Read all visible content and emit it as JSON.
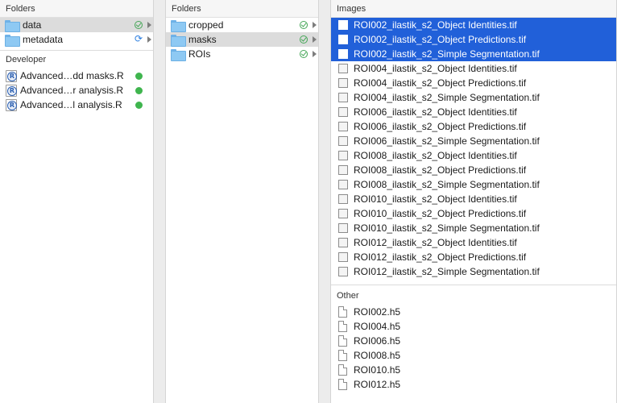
{
  "column1": {
    "folders_header": "Folders",
    "folders": [
      {
        "name": "data",
        "status": "synced",
        "selected": true
      },
      {
        "name": "metadata",
        "status": "syncing",
        "selected": false
      }
    ],
    "developer_header": "Developer",
    "developer_files": [
      {
        "name": "Advanced…dd masks.R",
        "status": "ok"
      },
      {
        "name": "Advanced…r analysis.R",
        "status": "ok"
      },
      {
        "name": "Advanced…l analysis.R",
        "status": "ok"
      }
    ]
  },
  "column2": {
    "folders_header": "Folders",
    "folders": [
      {
        "name": "cropped",
        "status": "synced",
        "selected": false
      },
      {
        "name": "masks",
        "status": "synced",
        "selected": true
      },
      {
        "name": "ROIs",
        "status": "synced",
        "selected": false
      }
    ]
  },
  "column3": {
    "images_header": "Images",
    "images": [
      {
        "name": "ROI002_ilastik_s2_Object Identities.tif",
        "selected": true
      },
      {
        "name": "ROI002_ilastik_s2_Object Predictions.tif",
        "selected": true
      },
      {
        "name": "ROI002_ilastik_s2_Simple Segmentation.tif",
        "selected": true
      },
      {
        "name": "ROI004_ilastik_s2_Object Identities.tif",
        "selected": false
      },
      {
        "name": "ROI004_ilastik_s2_Object Predictions.tif",
        "selected": false
      },
      {
        "name": "ROI004_ilastik_s2_Simple Segmentation.tif",
        "selected": false
      },
      {
        "name": "ROI006_ilastik_s2_Object Identities.tif",
        "selected": false
      },
      {
        "name": "ROI006_ilastik_s2_Object Predictions.tif",
        "selected": false
      },
      {
        "name": "ROI006_ilastik_s2_Simple Segmentation.tif",
        "selected": false
      },
      {
        "name": "ROI008_ilastik_s2_Object Identities.tif",
        "selected": false
      },
      {
        "name": "ROI008_ilastik_s2_Object Predictions.tif",
        "selected": false
      },
      {
        "name": "ROI008_ilastik_s2_Simple Segmentation.tif",
        "selected": false
      },
      {
        "name": "ROI010_ilastik_s2_Object Identities.tif",
        "selected": false
      },
      {
        "name": "ROI010_ilastik_s2_Object Predictions.tif",
        "selected": false
      },
      {
        "name": "ROI010_ilastik_s2_Simple Segmentation.tif",
        "selected": false
      },
      {
        "name": "ROI012_ilastik_s2_Object Identities.tif",
        "selected": false
      },
      {
        "name": "ROI012_ilastik_s2_Object Predictions.tif",
        "selected": false
      },
      {
        "name": "ROI012_ilastik_s2_Simple Segmentation.tif",
        "selected": false
      }
    ],
    "other_header": "Other",
    "other_files": [
      {
        "name": "ROI002.h5"
      },
      {
        "name": "ROI004.h5"
      },
      {
        "name": "ROI006.h5"
      },
      {
        "name": "ROI008.h5"
      },
      {
        "name": "ROI010.h5"
      },
      {
        "name": "ROI012.h5"
      }
    ]
  },
  "icons": {
    "folder": "folder-icon",
    "r_script": "r-file-icon",
    "image_file": "image-file-icon",
    "generic_file": "document-icon",
    "synced": "sync-check-icon",
    "syncing": "sync-arrows-icon",
    "ok_dot": "green-dot-icon",
    "expand": "chevron-right-icon"
  },
  "colors": {
    "selection_blue": "#2160d9",
    "selection_grey": "#dcdcdc",
    "folder_blue": "#8ec9f3",
    "status_green": "#3fb54e",
    "sync_blue": "#2d7fe0"
  }
}
